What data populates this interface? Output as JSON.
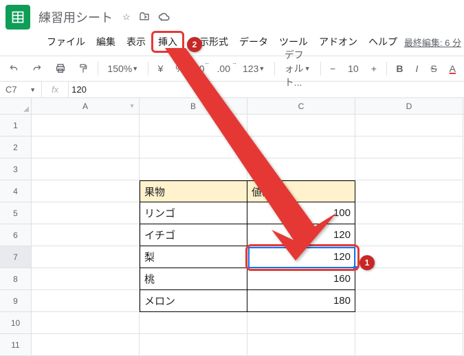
{
  "doc": {
    "title": "練習用シート"
  },
  "menu": {
    "file": "ファイル",
    "edit": "編集",
    "view": "表示",
    "insert": "挿入",
    "format": "表示形式",
    "data": "データ",
    "tools": "ツール",
    "addons": "アドオン",
    "help": "ヘルプ",
    "last_edit": "最終編集: 6 分"
  },
  "toolbar": {
    "zoom": "150%",
    "currency": "¥",
    "percent": "%",
    "dec_dec": ".0",
    "dec_inc": ".00",
    "more_fmt": "123",
    "font": "デフォルト...",
    "font_size": "10",
    "bold": "B",
    "italic": "I",
    "strike": "S",
    "color": "A"
  },
  "name_box": {
    "ref": "C7",
    "fx": "fx",
    "formula": "120"
  },
  "columns": [
    "A",
    "B",
    "C",
    "D"
  ],
  "row_numbers": [
    "1",
    "2",
    "3",
    "4",
    "5",
    "6",
    "7",
    "8",
    "9",
    "10",
    "11"
  ],
  "active_row_index": 6,
  "table": {
    "header": {
      "b": "果物",
      "c": "値段"
    },
    "rows": [
      {
        "b": "リンゴ",
        "c": "100"
      },
      {
        "b": "イチゴ",
        "c": "120"
      },
      {
        "b": "梨",
        "c": "120"
      },
      {
        "b": "桃",
        "c": "160"
      },
      {
        "b": "メロン",
        "c": "180"
      }
    ]
  },
  "annotations": {
    "badge1": "1",
    "badge2": "2"
  },
  "chart_data": {
    "type": "table",
    "title": "",
    "columns": [
      "果物",
      "値段"
    ],
    "rows": [
      [
        "リンゴ",
        100
      ],
      [
        "イチゴ",
        120
      ],
      [
        "梨",
        120
      ],
      [
        "桃",
        160
      ],
      [
        "メロン",
        180
      ]
    ]
  }
}
